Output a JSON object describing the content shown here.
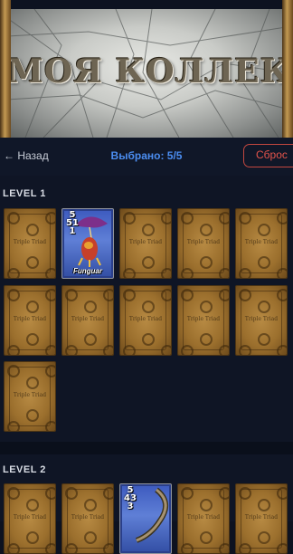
{
  "banner": {
    "title": "МОЯ КОЛЛЕКЦИЯ"
  },
  "toolbar": {
    "back_label": "← Назад",
    "selected_label": "Выбрано: 5/5",
    "reset_label": "Сброс"
  },
  "levels": [
    {
      "label": "LEVEL 1",
      "cards": [
        {
          "type": "back",
          "brand": "Triple Triad"
        },
        {
          "type": "face",
          "name": "Funguar",
          "ranks": {
            "top": "5",
            "left": "5",
            "right": "1",
            "bottom": "1"
          }
        },
        {
          "type": "back",
          "brand": "Triple Triad"
        },
        {
          "type": "back",
          "brand": "Triple Triad"
        },
        {
          "type": "back",
          "brand": "Triple Triad"
        },
        {
          "type": "back",
          "brand": "Triple Triad"
        },
        {
          "type": "back",
          "brand": "Triple Triad"
        },
        {
          "type": "back",
          "brand": "Triple Triad"
        },
        {
          "type": "back",
          "brand": "Triple Triad"
        },
        {
          "type": "back",
          "brand": "Triple Triad"
        },
        {
          "type": "back",
          "brand": "Triple Triad"
        }
      ]
    },
    {
      "label": "LEVEL 2",
      "cards": [
        {
          "type": "back",
          "brand": "Triple Triad"
        },
        {
          "type": "back",
          "brand": "Triple Triad"
        },
        {
          "type": "face",
          "name": "",
          "ranks": {
            "top": "5",
            "left": "4",
            "right": "3",
            "bottom": "3"
          }
        },
        {
          "type": "back",
          "brand": "Triple Triad"
        },
        {
          "type": "back",
          "brand": "Triple Triad"
        }
      ]
    }
  ],
  "colors": {
    "background": "#0d1220",
    "accent": "#4b8df0",
    "danger": "#e4544b"
  }
}
